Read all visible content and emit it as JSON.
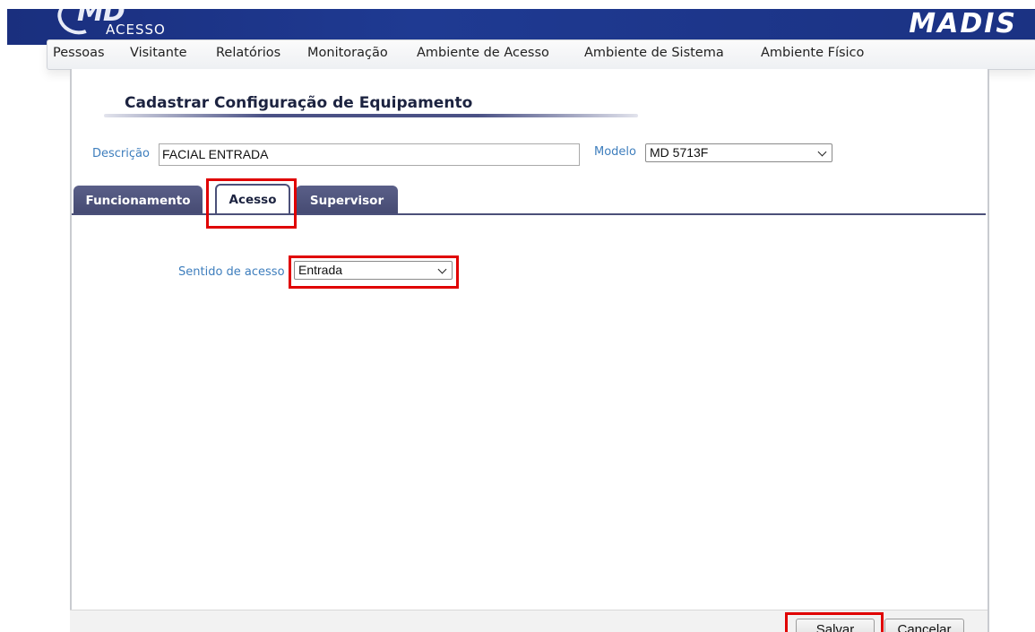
{
  "header": {
    "brand_left_main": "MD",
    "brand_left_sub": "ACESSO",
    "brand_right": "MADIS",
    "bar_color": "#1f3a92"
  },
  "menu": {
    "items": [
      {
        "label": "Pessoas"
      },
      {
        "label": "Visitante"
      },
      {
        "label": "Relatórios"
      },
      {
        "label": "Monitoração"
      },
      {
        "label": "Ambiente de Acesso"
      },
      {
        "label": "Ambiente de Sistema"
      },
      {
        "label": "Ambiente Físico"
      }
    ]
  },
  "page": {
    "title": "Cadastrar Configuração de Equipamento"
  },
  "form": {
    "descricao_label": "Descrição",
    "descricao_value": "FACIAL ENTRADA",
    "modelo_label": "Modelo",
    "modelo_value": "MD 5713F"
  },
  "tabs": [
    {
      "label": "Funcionamento",
      "active": false
    },
    {
      "label": "Acesso",
      "active": true
    },
    {
      "label": "Supervisor",
      "active": false
    }
  ],
  "acesso_tab": {
    "sentido_label": "Sentido de acesso",
    "sentido_value": "Entrada"
  },
  "buttons": {
    "save_label": "Salvar",
    "cancel_label": "Cancelar"
  },
  "colors": {
    "tab_inactive": "#464b73",
    "highlight": "#e00000",
    "label_blue": "#3e7ebd"
  }
}
